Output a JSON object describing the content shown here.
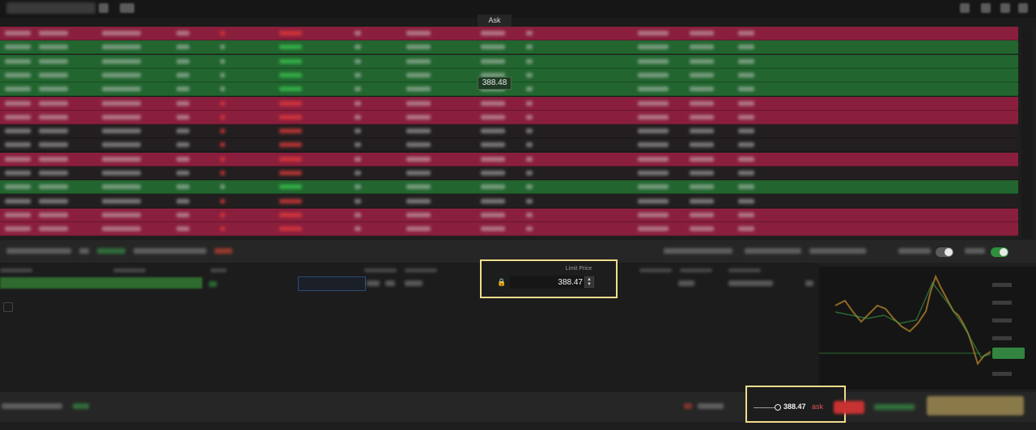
{
  "grid": {
    "ask_column_header": "Ask",
    "hover_price": "388.48",
    "rows": [
      "red",
      "green",
      "green",
      "green",
      "green",
      "red",
      "red",
      "dark",
      "dark",
      "red",
      "dark",
      "green",
      "dark",
      "red",
      "red"
    ]
  },
  "order_entry": {
    "limit_price_label": "Limit Price",
    "limit_price_value": "388.47",
    "stepper_up": "▲",
    "stepper_down": "▼",
    "lock_icon": "🔒"
  },
  "bottom": {
    "reference_price": "388.47",
    "reference_type": "ask"
  },
  "toggles": {
    "states": [
      false,
      true
    ]
  },
  "colors": {
    "red_row": "#8a1f3d",
    "green_row": "#22652f",
    "highlight_box": "#f0dc8c",
    "ask_text": "#e55252"
  }
}
